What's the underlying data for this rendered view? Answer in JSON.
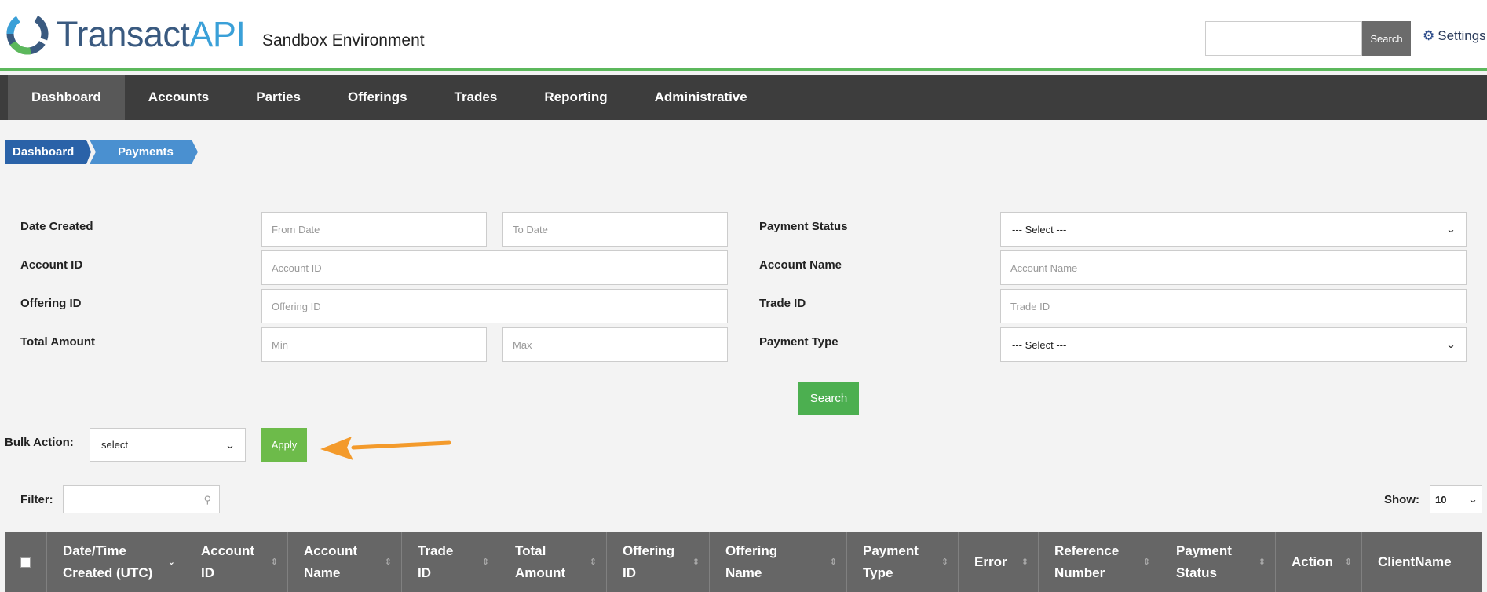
{
  "header": {
    "logo_part1": "Transact",
    "logo_part2": "API",
    "environment": "Sandbox Environment",
    "search_button": "Search",
    "settings_label": "Settings",
    "accent_color": "#5cb85c"
  },
  "nav": {
    "items": [
      {
        "label": "Dashboard",
        "active": true
      },
      {
        "label": "Accounts"
      },
      {
        "label": "Parties"
      },
      {
        "label": "Offerings"
      },
      {
        "label": "Trades"
      },
      {
        "label": "Reporting"
      },
      {
        "label": "Administrative"
      }
    ]
  },
  "breadcrumb": [
    "Dashboard",
    "Payments"
  ],
  "form": {
    "date_created_label": "Date Created",
    "from_date_placeholder": "From Date",
    "to_date_placeholder": "To Date",
    "payment_status_label": "Payment Status",
    "payment_status_value": "--- Select ---",
    "account_id_label": "Account ID",
    "account_id_placeholder": "Account ID",
    "account_name_label": "Account Name",
    "account_name_placeholder": "Account Name",
    "offering_id_label": "Offering ID",
    "offering_id_placeholder": "Offering ID",
    "trade_id_label": "Trade ID",
    "trade_id_placeholder": "Trade ID",
    "total_amount_label": "Total Amount",
    "min_placeholder": "Min",
    "max_placeholder": "Max",
    "payment_type_label": "Payment Type",
    "payment_type_value": "--- Select ---",
    "search_button": "Search"
  },
  "bulk": {
    "label": "Bulk Action:",
    "select_value": "select",
    "apply_button": "Apply"
  },
  "filter": {
    "label": "Filter:",
    "show_label": "Show:",
    "show_value": "10"
  },
  "table": {
    "columns": [
      [
        "Date/Time",
        "Created (UTC)"
      ],
      [
        "Account",
        "ID"
      ],
      [
        "Account",
        "Name"
      ],
      [
        "Trade",
        "ID"
      ],
      [
        "Total",
        "Amount"
      ],
      [
        "Offering",
        "ID"
      ],
      [
        "Offering",
        "Name"
      ],
      [
        "Payment",
        "Type"
      ],
      [
        "Error",
        ""
      ],
      [
        "Reference",
        "Number"
      ],
      [
        "Payment",
        "Status"
      ],
      [
        "Action",
        ""
      ],
      [
        "ClientName",
        ""
      ]
    ]
  }
}
